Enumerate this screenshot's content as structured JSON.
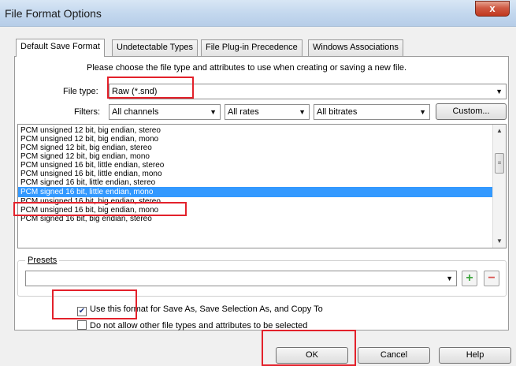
{
  "window": {
    "title": "File Format Options",
    "close_glyph": "x"
  },
  "tabs": [
    {
      "label": "Default Save Format",
      "active": true
    },
    {
      "label": "Undetectable Types",
      "active": false
    },
    {
      "label": "File Plug-in Precedence",
      "active": false
    },
    {
      "label": "Windows Associations",
      "active": false
    }
  ],
  "instructions": "Please choose the file type and attributes to use when creating or saving a new file.",
  "file_type": {
    "label": "File type:",
    "value": "Raw (*.snd)"
  },
  "filters": {
    "label": "Filters:",
    "channels": "All channels",
    "rates": "All rates",
    "bitrates": "All bitrates",
    "custom_label": "Custom..."
  },
  "format_list": {
    "items": [
      "PCM unsigned 12 bit, big endian, stereo",
      "PCM unsigned 12 bit, big endian, mono",
      "PCM signed 12 bit, big endian, stereo",
      "PCM signed 12 bit, big endian, mono",
      "PCM unsigned 16 bit, little endian, stereo",
      "PCM unsigned 16 bit, little endian, mono",
      "PCM signed 16 bit, little endian, stereo",
      "PCM signed 16 bit, little endian, mono",
      "PCM unsigned 16 bit, big endian, stereo",
      "PCM unsigned 16 bit, big endian, mono",
      "PCM signed 16 bit, big endian, stereo"
    ],
    "selected_index": 7
  },
  "presets": {
    "label": "Presets",
    "value": ""
  },
  "options": {
    "use_format_label": "Use this format for Save As, Save Selection As, and Copy To",
    "use_format_checked": true,
    "disallow_label": "Do not allow other file types and attributes to be selected",
    "disallow_checked": false
  },
  "buttons": {
    "ok": "OK",
    "cancel": "Cancel",
    "help": "Help"
  },
  "colors": {
    "selection": "#3399ff",
    "annotation": "#e3212b",
    "add": "#3fa63f",
    "remove": "#d9534f"
  }
}
